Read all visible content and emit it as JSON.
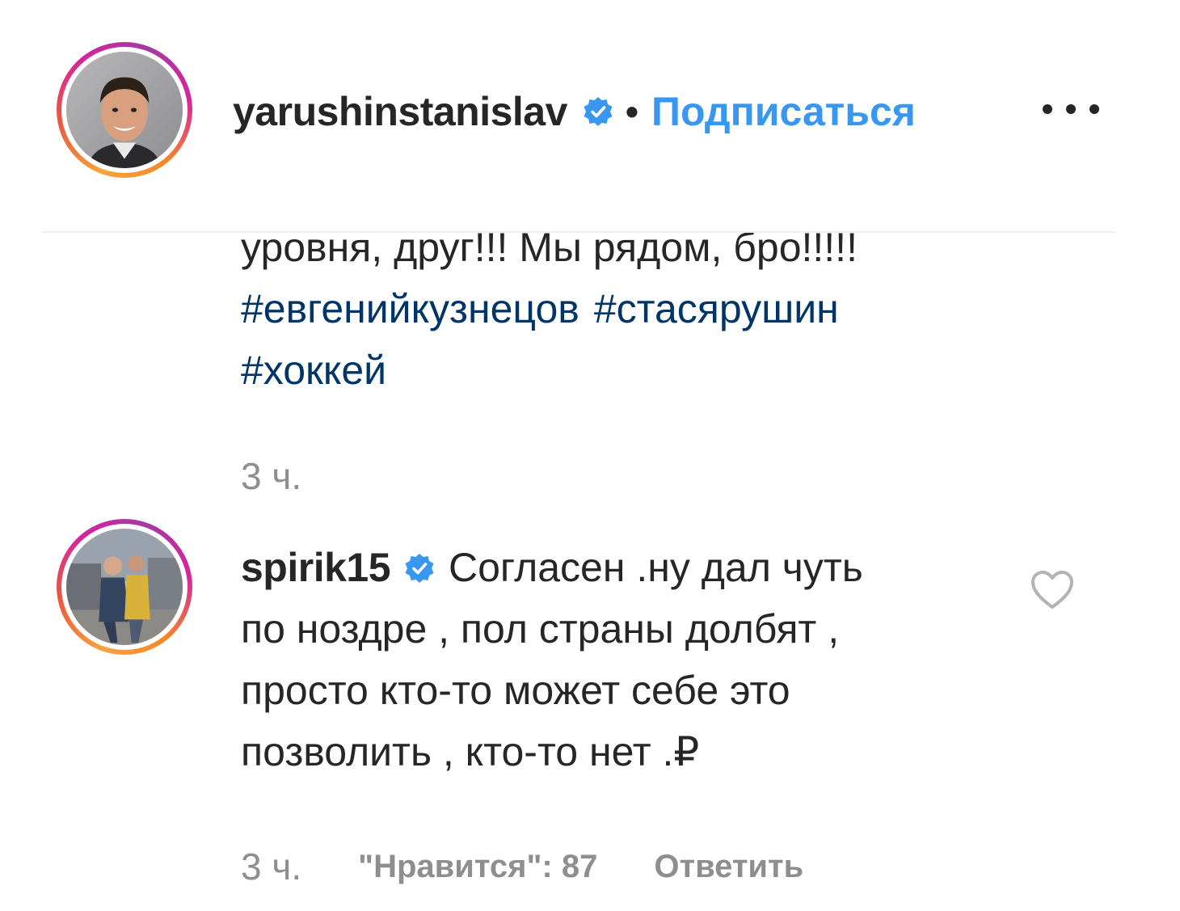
{
  "post_header": {
    "username": "yarushinstanislav",
    "verified_icon": "verified-badge-icon",
    "separator": "•",
    "follow_label": "Подписаться",
    "more_icon": "more-options-icon"
  },
  "caption": {
    "lines": [
      "уровня, друг!!! Мы рядом, бро!!!!!"
    ],
    "hashtags_line1": [
      "#евгенийкузнецов",
      "#стасярушин"
    ],
    "hashtags_line2": [
      "#хоккей"
    ],
    "time": "3 ч."
  },
  "comment": {
    "username": "spirik15",
    "verified_icon": "verified-badge-icon",
    "lines": [
      "Согласен .ну дал чуть",
      "по ноздре , пол страны долбят ,",
      "просто кто-то может себе это",
      "позволить , кто-то нет .₽"
    ],
    "like_icon": "heart-outline-icon",
    "time": "3 ч.",
    "likes_label": "\"Нравится\": 87",
    "reply_label": "Ответить"
  },
  "colors": {
    "text": "#262626",
    "link_blue": "#3897f0",
    "hashtag": "#003569",
    "muted": "#8e8e8e",
    "verified": "#3897f0"
  }
}
